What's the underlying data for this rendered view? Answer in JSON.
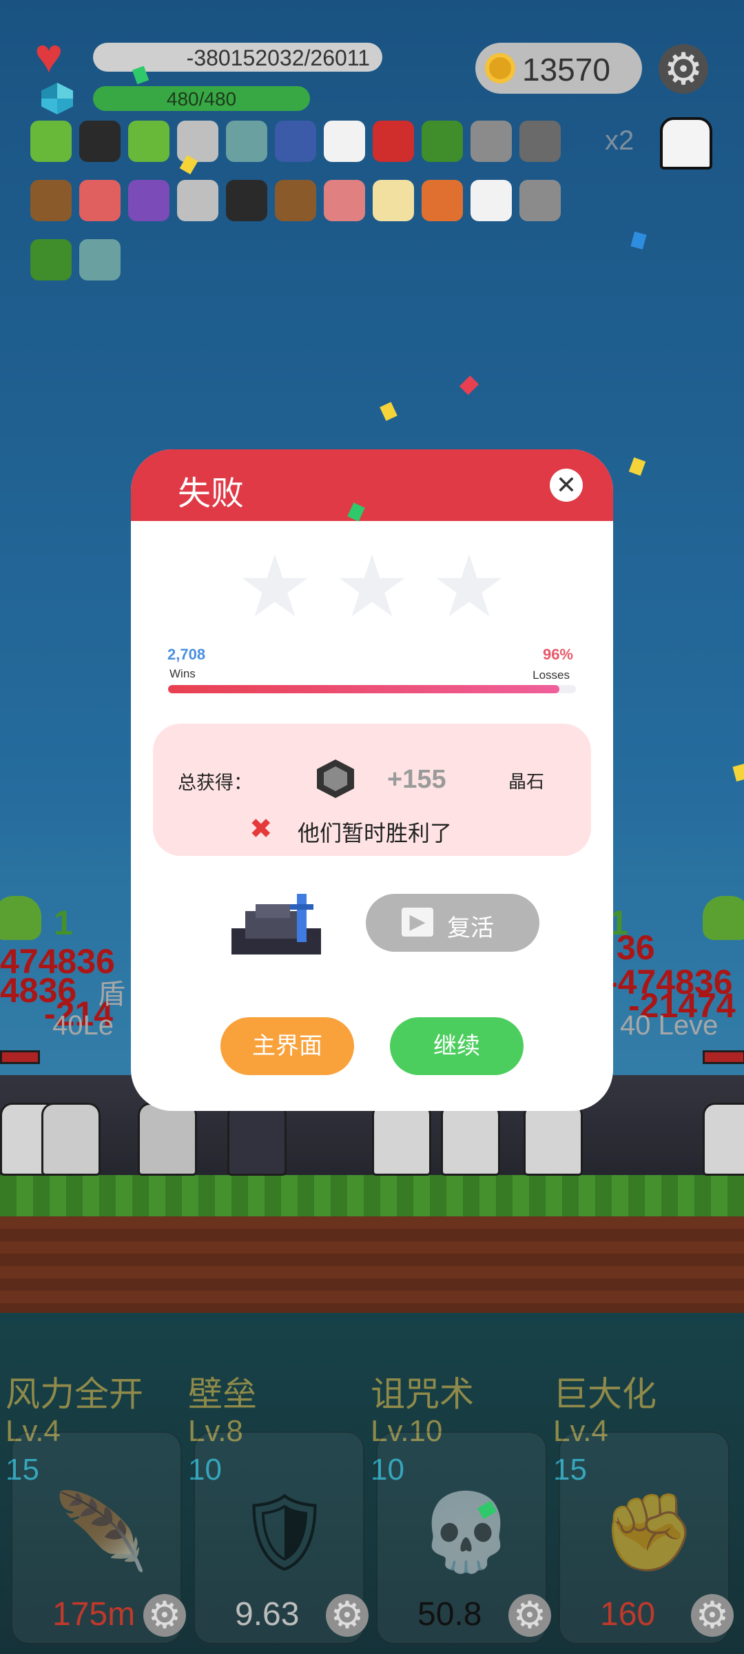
{
  "hud": {
    "hp_text": "-380152032/26011",
    "mp_text": "480/480",
    "mp_fraction": 1.0,
    "coins": "13570",
    "multiplier": "x2"
  },
  "inventory": {
    "icons": [
      "green-monster-icon",
      "bat-icon",
      "green-monster-icon",
      "sword-icon",
      "shield-ring-icon",
      "shield-icon",
      "flower-icon",
      "apple-icon",
      "tree-icon",
      "hook-icon",
      "horned-helmet-icon",
      "dagger-icon",
      "boot-icon",
      "orb-icon",
      "sword-icon",
      "book-icon",
      "dagger-icon",
      "pill-icon",
      "egg-icon",
      "torch-icon",
      "flower-icon",
      "hook-icon",
      "tree-icon",
      "shield-ring-icon"
    ]
  },
  "modal": {
    "title": "失败",
    "wins_value": "2,708",
    "wins_label": "Wins",
    "losses_value": "96%",
    "losses_label": "Losses",
    "progress_fraction": 0.96,
    "reward_label": "总获得：",
    "reward_value": "+155",
    "reward_unit": "晶石",
    "fail_message": "他们暂时胜利了",
    "revive_label": "复活",
    "home_label": "主界面",
    "continue_label": "继续"
  },
  "battle": {
    "left_count": "1",
    "right_count": "1",
    "left_damage_1": "474836",
    "left_damage_2": "4836",
    "left_damage_3": "-214",
    "left_level": "40Le",
    "left_shield": "盾",
    "right_damage_1": "36",
    "right_damage_2": "-474836",
    "right_damage_3": "-21474",
    "right_level": "40 Leve"
  },
  "skills": [
    {
      "name": "风力全开",
      "level": "Lv.4",
      "cost": "15",
      "value": "175m",
      "value_color": "#c0392b",
      "icon": "feather-icon"
    },
    {
      "name": "壁垒",
      "level": "Lv.8",
      "cost": "10",
      "value": "9.63",
      "value_color": "#bdbdbd",
      "icon": "armor-icon"
    },
    {
      "name": "诅咒术",
      "level": "Lv.10",
      "cost": "10",
      "value": "50.8",
      "value_color": "#111111",
      "icon": "skull-icon"
    },
    {
      "name": "巨大化",
      "level": "Lv.4",
      "cost": "15",
      "value": "160",
      "value_color": "#c0392b",
      "icon": "fist-icon"
    }
  ],
  "colors": {
    "header_red": "#df3a46",
    "home_orange": "#f9a23c",
    "continue_green": "#4cce5e"
  }
}
